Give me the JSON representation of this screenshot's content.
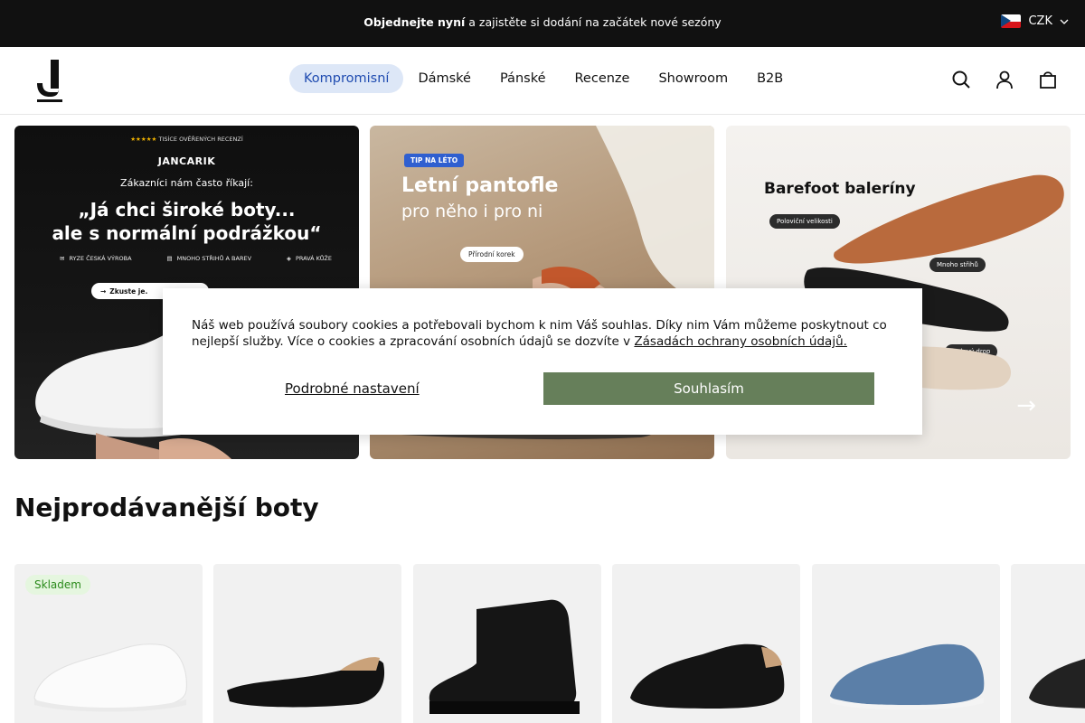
{
  "topbar": {
    "message_bold": "Objednejte nyní",
    "message_rest": "a zajistěte si dodání na začátek nové sezóny",
    "currency": "CZK"
  },
  "header": {
    "nav": [
      {
        "label": "Kompromisní",
        "active": true
      },
      {
        "label": "Dámské",
        "active": false
      },
      {
        "label": "Pánské",
        "active": false
      },
      {
        "label": "Recenze",
        "active": false
      },
      {
        "label": "Showroom",
        "active": false
      },
      {
        "label": "B2B",
        "active": false
      }
    ],
    "icons": [
      "search-icon",
      "user-icon",
      "cart-icon"
    ]
  },
  "banners": {
    "b1": {
      "stars_text": "TISÍCE OVĚŘENÝCH RECENZÍ",
      "brand": "JANCARIK",
      "sub": "Zákazníci nám často říkají:",
      "headline_1": "„Já chci široké boty...",
      "headline_2": "ale s normální podrážkou“",
      "features": [
        "RYZE ČESKÁ VÝROBA",
        "MNOHO STŘIHŮ A BAREV",
        "PRAVÁ KŮŽE"
      ],
      "cta": "Zkuste je."
    },
    "b2": {
      "tag": "TIP NA LÉTO",
      "title": "Letní pantofle",
      "sub": "pro něho i pro ni",
      "pill": "Přírodní korek"
    },
    "b3": {
      "title": "Barefoot baleríny",
      "pills": [
        "Poloviční velikosti",
        "Mnoho střihů",
        "Nulový drop"
      ]
    }
  },
  "cookie": {
    "text": "Náš web používá soubory cookies a potřebovali bychom k nim Váš souhlas. Díky nim Vám můžeme poskytnout co nejlepší služby. Více o cookies a zpracování osobních údajů se dozvíte v ",
    "link": "Zásadách ochrany osobních údajů.",
    "settings": "Podrobné nastavení",
    "accept": "Souhlasím"
  },
  "section": {
    "title": "Nejprodávanější boty",
    "badge": "Skladem"
  },
  "colors": {
    "accent_green": "#667f5a",
    "nav_active_bg": "#dde7f7",
    "nav_active_text": "#1f4bb0"
  }
}
